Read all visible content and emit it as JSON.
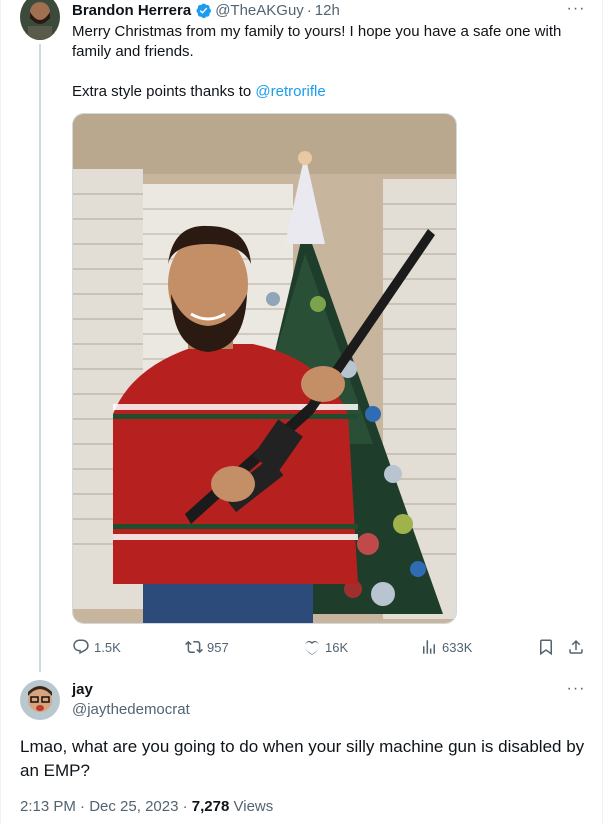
{
  "tweet": {
    "author_name": "Brandon Herrera",
    "handle": "@TheAKGuy",
    "separator": "·",
    "time": "12h",
    "more": "···",
    "text_line1": "Merry Christmas from my family to yours! I hope you have a safe one with family and friends.",
    "text_line2_prefix": "Extra style points thanks to ",
    "mention": "@retrorifle",
    "stats": {
      "replies": "1.5K",
      "retweets": "957",
      "likes": "16K",
      "views": "633K"
    }
  },
  "reply": {
    "author_name": "jay",
    "handle": "@jaythedemocrat",
    "more": "···",
    "text": "Lmao, what are you going to do when your silly machine gun is disabled by an EMP?",
    "time": "2:13 PM",
    "separator": "·",
    "date": "Dec 25, 2023",
    "separator2": "·",
    "views_count": "7,278",
    "views_label": "Views"
  },
  "colors": {
    "accent": "#1d9bf0",
    "text": "#0f1419",
    "muted": "#536471",
    "border": "#cfd9de"
  },
  "icons": [
    "verified-badge-icon",
    "reply-icon",
    "retweet-icon",
    "like-icon",
    "views-icon",
    "bookmark-icon",
    "share-icon",
    "more-icon"
  ]
}
